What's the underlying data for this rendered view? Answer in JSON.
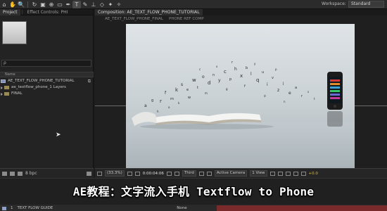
{
  "toolbar": {
    "workspace_label": "Workspace:",
    "workspace_value": "Standard"
  },
  "left_panel": {
    "tabs": [
      "Project",
      "Effect Controls: PHI"
    ],
    "search_placeholder": "ρ",
    "list_header": "Name",
    "items": [
      {
        "label": "AE_TEXT_FLOW_PHONE_TUTORIAL",
        "type": "comp"
      },
      {
        "label": "ae_textflow_phone_1 Layers",
        "type": "folder"
      },
      {
        "label": "FINAL",
        "type": "folder"
      }
    ],
    "bpc_label": "8 bpc"
  },
  "composition": {
    "tab_label": "Composition: AE_TEXT_FLOW_PHONE_TUTORIAL",
    "breadcrumbs": [
      "AE_TEXT_FLOW_PHONE_FINAL",
      "PHONE REF COMP"
    ],
    "zoom": "(33.3%)",
    "timecode": "0:00:04:06",
    "resolution": "Third",
    "camera": "Active Camera",
    "view": "1 View",
    "exposure": "+0.0"
  },
  "timeline": {
    "layer_number": "1",
    "layer_name": "TEXT FLOW GUIDE",
    "blend_mode": "None"
  },
  "subtitle": "AE教程：文字流入手机 Textflow to Phone"
}
